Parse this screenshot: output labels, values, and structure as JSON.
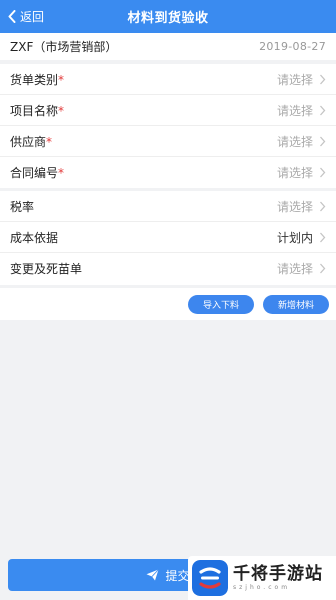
{
  "navbar": {
    "back_label": "返回",
    "title": "材料到货验收"
  },
  "header": {
    "department": "ZXF（市场营销部）",
    "date": "2019-08-27"
  },
  "group1": [
    {
      "label": "货单类别",
      "required": "*",
      "value": "请选择"
    },
    {
      "label": "项目名称",
      "required": "*",
      "value": "请选择"
    },
    {
      "label": "供应商",
      "required": "*",
      "value": "请选择"
    },
    {
      "label": "合同编号",
      "required": "*",
      "value": "请选择"
    }
  ],
  "group2": [
    {
      "label": "税率",
      "value": "请选择"
    },
    {
      "label": "成本依据",
      "value": "计划内"
    },
    {
      "label": "变更及死苗单",
      "value": "请选择"
    }
  ],
  "actions": {
    "import_label": "导入下料",
    "add_label": "新增材料"
  },
  "submit": {
    "label": "提交"
  },
  "watermark": {
    "title": "千将手游站",
    "sub": "szjho.com"
  },
  "colors": {
    "primary": "#3a8bf0",
    "required": "#e23b3b",
    "placeholder": "#aaaaaa"
  }
}
